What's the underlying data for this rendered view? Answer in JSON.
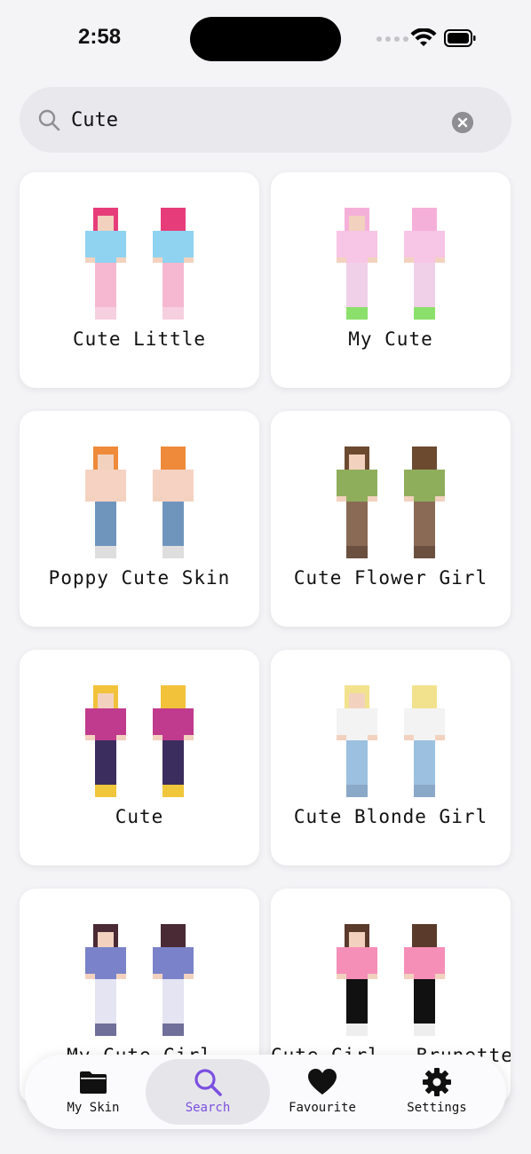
{
  "status_bar": {
    "time": "2:58"
  },
  "search": {
    "value": "Cute"
  },
  "results": [
    {
      "label": "Cute Little",
      "colors": {
        "hair": "#e63d7a",
        "top": "#8fd3f0",
        "legs": "#f6b8d0",
        "shoes": "#f7d0e0"
      }
    },
    {
      "label": "My Cute",
      "colors": {
        "hair": "#f5b0d9",
        "top": "#f7c5e5",
        "legs": "#f0d0e8",
        "shoes": "#8be06b"
      }
    },
    {
      "label": "Poppy Cute Skin",
      "colors": {
        "hair": "#ee8a3a",
        "top": "#f6d2c2",
        "legs": "#6f95bd",
        "shoes": "#dedede"
      }
    },
    {
      "label": "Cute Flower Girl",
      "colors": {
        "hair": "#6b4a2f",
        "top": "#8fae5c",
        "legs": "#8a6a55",
        "shoes": "#6b5040"
      }
    },
    {
      "label": "Cute",
      "colors": {
        "hair": "#f2c23a",
        "top": "#c03a8e",
        "legs": "#3b2d5e",
        "shoes": "#f0c63a"
      }
    },
    {
      "label": "Cute Blonde Girl",
      "colors": {
        "hair": "#f2e28e",
        "top": "#f3f3f3",
        "legs": "#9cc0e0",
        "shoes": "#8aa8c8"
      }
    },
    {
      "label": "My Cute Girl",
      "colors": {
        "hair": "#4a2a34",
        "top": "#7a83c9",
        "legs": "#e4e4f2",
        "shoes": "#6f6f9a"
      }
    },
    {
      "label": "Cute Girl - Brunette",
      "colors": {
        "hair": "#5a3a2a",
        "top": "#f58fb8",
        "legs": "#111111",
        "shoes": "#eeeeee"
      }
    }
  ],
  "tabs": [
    {
      "label": "My Skin",
      "icon": "folder-icon"
    },
    {
      "label": "Search",
      "icon": "search-icon"
    },
    {
      "label": "Favourite",
      "icon": "heart-icon"
    },
    {
      "label": "Settings",
      "icon": "gear-icon"
    }
  ],
  "theme": {
    "accent": "#7b4fe0",
    "background": "#f4f4f7"
  }
}
